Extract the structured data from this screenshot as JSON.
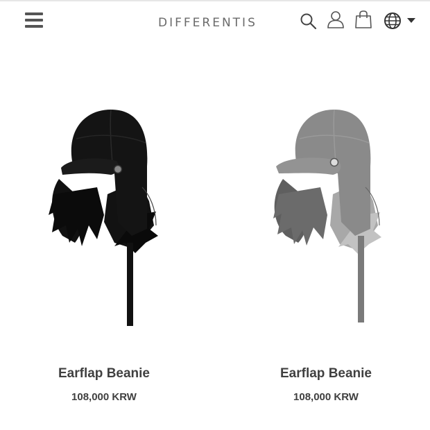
{
  "header": {
    "brand": "DIFFERENTIS",
    "icons": [
      "menu-icon",
      "search-icon",
      "user-icon",
      "shopping-bag-icon",
      "globe-icon",
      "caret-down-icon"
    ]
  },
  "products": [
    {
      "name": "Earflap Beanie",
      "price": "108,000 KRW",
      "color": "#111111"
    },
    {
      "name": "Earflap Beanie",
      "price": "108,000 KRW",
      "color": "#8f8f8f"
    }
  ]
}
